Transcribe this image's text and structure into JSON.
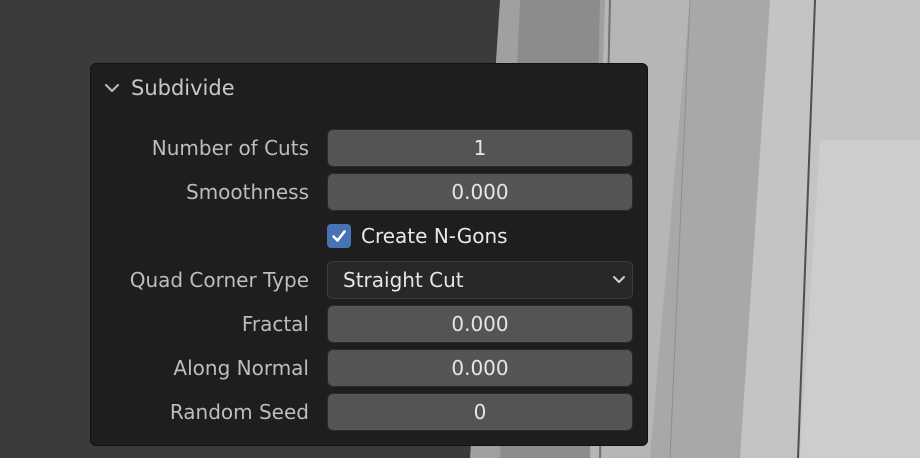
{
  "panel": {
    "title": "Subdivide",
    "fields": {
      "number_of_cuts": {
        "label": "Number of Cuts",
        "value": "1"
      },
      "smoothness": {
        "label": "Smoothness",
        "value": "0.000"
      },
      "create_ngons": {
        "label": "Create N-Gons",
        "checked": true
      },
      "quad_corner_type": {
        "label": "Quad Corner Type",
        "value": "Straight Cut"
      },
      "fractal": {
        "label": "Fractal",
        "value": "0.000"
      },
      "along_normal": {
        "label": "Along Normal",
        "value": "0.000"
      },
      "random_seed": {
        "label": "Random Seed",
        "value": "0"
      }
    }
  },
  "icons": {
    "collapse": "chevron-down-icon",
    "checkbox": "checkmark-icon",
    "dropdown": "chevron-down-icon"
  },
  "colors": {
    "checkbox_accent": "#4772b3",
    "panel_bg": "#1e1e1e",
    "field_bg": "#545454"
  }
}
